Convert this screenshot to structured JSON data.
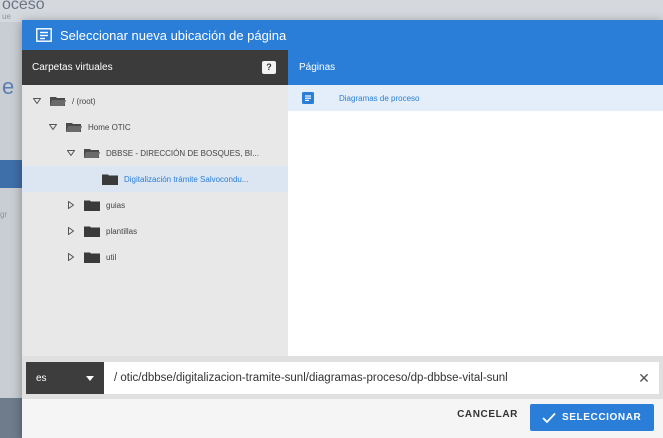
{
  "background": {
    "title_fragment": "oceso",
    "subtitle_fragment": "ue",
    "letter": "e",
    "side_text": "gr"
  },
  "modal": {
    "title": "Seleccionar nueva ubicación de página",
    "header_icon": "move-page-icon"
  },
  "left_panel": {
    "header": "Carpetas virtuales",
    "help_label": "?",
    "tree": [
      {
        "label": "/ (root)",
        "expanded": true,
        "level": 0
      },
      {
        "label": "Home OTIC",
        "expanded": true,
        "level": 1
      },
      {
        "label": "DBBSE - DIRECCIÓN DE BOSQUES, BI...",
        "expanded": true,
        "level": 2
      },
      {
        "label": "Digitalización trámite Salvocondu...",
        "expanded": null,
        "level": 3,
        "selected": true
      },
      {
        "label": "guias",
        "expanded": false,
        "level": 1
      },
      {
        "label": "plantillas",
        "expanded": false,
        "level": 1
      },
      {
        "label": "util",
        "expanded": false,
        "level": 1
      }
    ]
  },
  "right_panel": {
    "header": "Páginas",
    "pages": [
      {
        "label": "Diagramas de proceso",
        "icon": "document-icon"
      }
    ]
  },
  "path_bar": {
    "language": "es",
    "path": "/ otic/dbbse/digitalizacion-tramite-sunl/diagramas-proceso/dp-dbbse-vital-sunl",
    "clear_label": "✕"
  },
  "footer": {
    "cancel_label": "CANCELAR",
    "select_label": "SELECCIONAR"
  },
  "colors": {
    "accent": "#2a7ed8",
    "dark_header": "#3b3b3b",
    "selected_row": "#dbe6f2"
  }
}
